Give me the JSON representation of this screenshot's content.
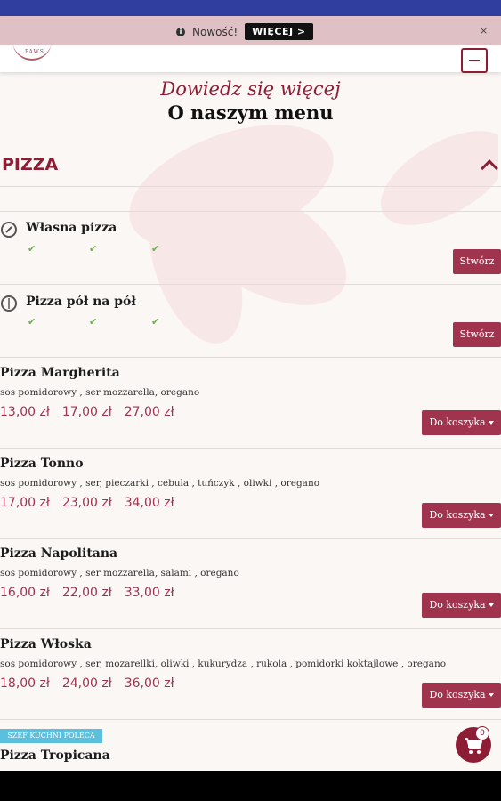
{
  "notice": {
    "text": "Nowość!",
    "button": "WIĘCEJ >",
    "close": "×"
  },
  "header": {
    "logo_text": "PAWS"
  },
  "hero": {
    "subtitle": "Dowiedz się więcej",
    "title": "O naszym menu"
  },
  "category": {
    "title": "PIZZA"
  },
  "custom": [
    {
      "name": "Własna pizza",
      "button": "Stwórz"
    },
    {
      "name": "Pizza pół na pół",
      "button": "Stwórz"
    }
  ],
  "items": [
    {
      "name": "Pizza Margherita",
      "desc": "sos pomidorowy , ser mozzarella, oregano",
      "prices": [
        "13,00 zł",
        "17,00 zł",
        "27,00 zł"
      ],
      "button": "Do koszyka"
    },
    {
      "name": "Pizza Tonno",
      "desc": "sos pomidorowy , ser, pieczarki , cebula , tuńczyk , oliwki , oregano",
      "prices": [
        "17,00 zł",
        "23,00 zł",
        "34,00 zł"
      ],
      "button": "Do koszyka"
    },
    {
      "name": "Pizza Napolitana",
      "desc": "sos pomidorowy , ser mozzarella, salami , oregano",
      "prices": [
        "16,00 zł",
        "22,00 zł",
        "33,00 zł"
      ],
      "button": "Do koszyka"
    },
    {
      "name": "Pizza Włoska",
      "desc": "sos pomidorowy , ser, mozarellki, oliwki , kukurydza , rukola , pomidorki koktajlowe , oregano",
      "prices": [
        "18,00 zł",
        "24,00 zł",
        "36,00 zł"
      ],
      "button": "Do koszyka"
    }
  ],
  "last_item": {
    "badge": "SZEF KUCHNI POLECA",
    "name": "Pizza Tropicana"
  },
  "cart": {
    "count": "0"
  },
  "colors": {
    "accent": "#a0344e",
    "status_bar": "#303f9f",
    "notice_bg": "#dfc0c5",
    "check": "#6ab04c",
    "badge": "#5bc0de"
  },
  "icons": {
    "notice": "info-icon",
    "custom_1": "compass-icon",
    "custom_2": "half-pizza-icon",
    "cart": "cart-icon",
    "collapse": "chevron-up-icon",
    "menu": "hamburger-icon"
  }
}
